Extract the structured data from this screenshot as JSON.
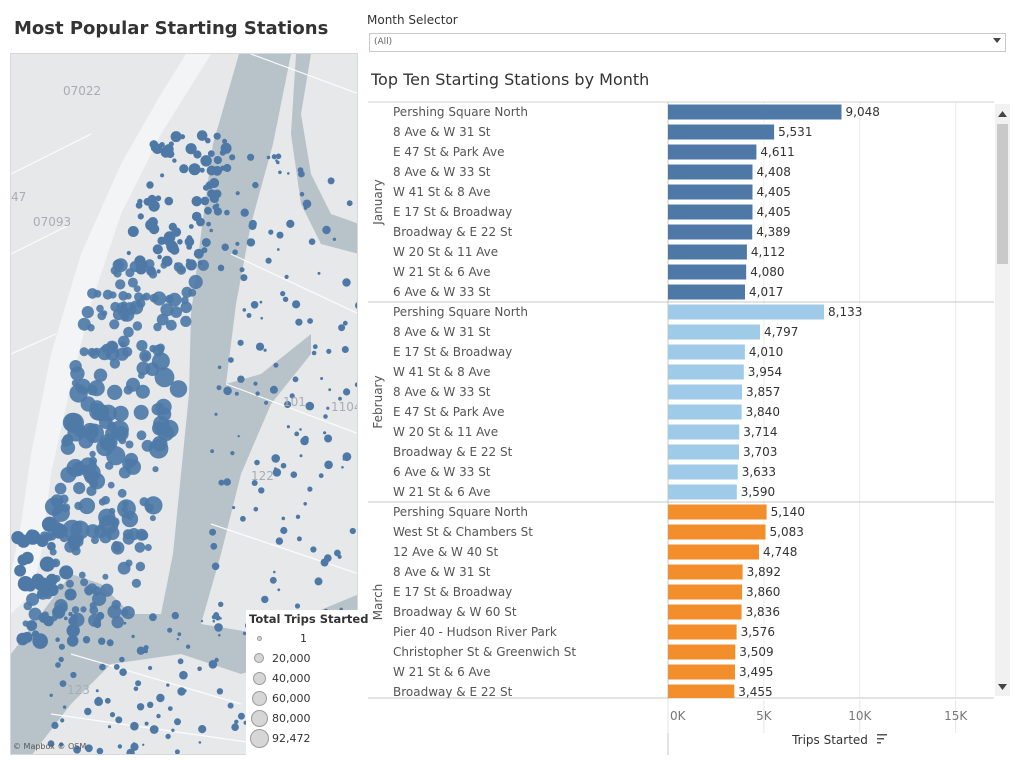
{
  "left_panel": {
    "title": "Most Popular Starting Stations",
    "map_credit": "© Mapbox © OSM",
    "map_labels": [
      "07022",
      "07093",
      "47",
      "1104",
      "123",
      "101",
      "122"
    ],
    "legend": {
      "title": "Total Trips Started",
      "items": [
        "1",
        "20,000",
        "40,000",
        "60,000",
        "80,000",
        "92,472"
      ],
      "item_values": [
        1,
        20000,
        40000,
        60000,
        80000,
        92472
      ]
    }
  },
  "filter": {
    "label": "Month Selector",
    "value": "(All)"
  },
  "chart_data": {
    "type": "bar",
    "orientation": "horizontal",
    "title": "Top Ten Starting Stations by Month",
    "xlabel": "Trips Started",
    "xlim": [
      0,
      17000
    ],
    "xticks": [
      0,
      5000,
      10000,
      15000
    ],
    "xtick_labels": [
      "0K",
      "5K",
      "10K",
      "15K"
    ],
    "grid": true,
    "panels": [
      {
        "month": "January",
        "color": "#4e79a7",
        "categories": [
          "Pershing Square North",
          "8 Ave & W 31 St",
          "E 47 St & Park Ave",
          "8 Ave & W 33 St",
          "W 41 St & 8 Ave",
          "E 17 St & Broadway",
          "Broadway & E 22 St",
          "W 20 St & 11 Ave",
          "W 21 St & 6 Ave",
          "6 Ave & W 33 St"
        ],
        "values": [
          9048,
          5531,
          4611,
          4408,
          4405,
          4405,
          4389,
          4112,
          4080,
          4017
        ],
        "labels": [
          "9,048",
          "5,531",
          "4,611",
          "4,408",
          "4,405",
          "4,405",
          "4,389",
          "4,112",
          "4,080",
          "4,017"
        ]
      },
      {
        "month": "February",
        "color": "#a0cbe8",
        "categories": [
          "Pershing Square North",
          "8 Ave & W 31 St",
          "E 17 St & Broadway",
          "W 41 St & 8 Ave",
          "8 Ave & W 33 St",
          "E 47 St & Park Ave",
          "W 20 St & 11 Ave",
          "Broadway & E 22 St",
          "6 Ave & W 33 St",
          "W 21 St & 6 Ave"
        ],
        "values": [
          8133,
          4797,
          4010,
          3954,
          3857,
          3840,
          3714,
          3703,
          3633,
          3590
        ],
        "labels": [
          "8,133",
          "4,797",
          "4,010",
          "3,954",
          "3,857",
          "3,840",
          "3,714",
          "3,703",
          "3,633",
          "3,590"
        ]
      },
      {
        "month": "March",
        "color": "#f28e2b",
        "categories": [
          "Pershing Square North",
          "West St & Chambers St",
          "12 Ave & W 40 St",
          "8 Ave & W 31 St",
          "E 17 St & Broadway",
          "Broadway & W 60 St",
          "Pier 40 - Hudson River Park",
          "Christopher St & Greenwich St",
          "W 21 St & 6 Ave",
          "Broadway & E 22 St"
        ],
        "values": [
          5140,
          5083,
          4748,
          3892,
          3860,
          3836,
          3576,
          3509,
          3495,
          3455
        ],
        "labels": [
          "5,140",
          "5,083",
          "4,748",
          "3,892",
          "3,860",
          "3,836",
          "3,576",
          "3,509",
          "3,495",
          "3,455"
        ]
      }
    ]
  }
}
